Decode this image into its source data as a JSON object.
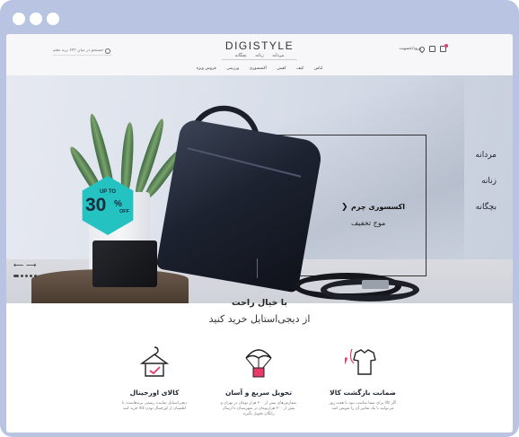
{
  "header": {
    "logo": "DIGISTYLE",
    "subnav": [
      "مردانه",
      "زنانه",
      "بچگانه"
    ],
    "mainnav": [
      "لباس",
      "کیف",
      "کفش",
      "اکسسوری",
      "ورزشی",
      "فروش ویژه"
    ],
    "search_placeholder": "جستجو در میان ۲۴۳ برند معتبر",
    "login_label": "ورود/عضویت"
  },
  "hero": {
    "badge_up": "UP TO",
    "badge_num": "30",
    "badge_pct": "%",
    "badge_off": "OFF",
    "categories": [
      "مردانه",
      "زنانه",
      "بچگانه"
    ],
    "promo_title": "اکسسوری چرم",
    "promo_chevron": "❯",
    "promo_sub": "موج تخفیف",
    "slider_arrows": "⟵ ⟶"
  },
  "tagline": {
    "line1": "با خیال راحت",
    "line2": "از دیجی‌استایل خرید کنید"
  },
  "features": [
    {
      "title": "ضمانت بازگشت کالا",
      "desc": "اگر کالا برای شما مناسب نبود تا هفت روز می‌توانید با یک تماس آن را تعویض کنید",
      "icon": "return-shirt-icon"
    },
    {
      "title": "تحویل سریع و آسان",
      "desc": "سفارش‌های بیش از ۲۰۰ هزار تومان در تهران و بیش از ۳۰۰ هزارتومان در شهرستان با ارسال رایگان تحویل بگیرید",
      "icon": "parachute-box-icon"
    },
    {
      "title": "کالای اورجینال",
      "desc": "دیجی‌استایل نماینده رسمی برندهاست؛ با اطمینان از اورجینال بودن کالا خرید کنید",
      "icon": "shirt-hanger-icon"
    }
  ],
  "colors": {
    "frame": "#b9c3e2",
    "badge": "#25c2c2",
    "accent": "#e93a6a"
  }
}
